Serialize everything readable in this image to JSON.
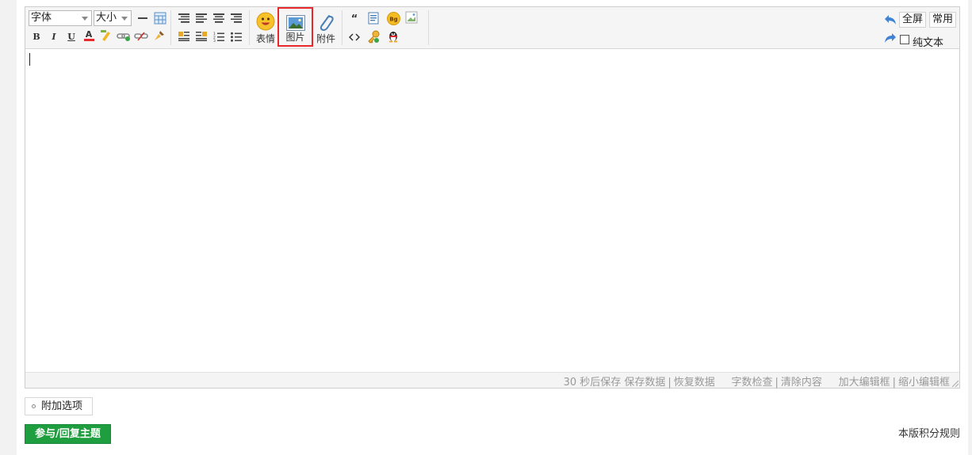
{
  "toolbar": {
    "font_select": "字体",
    "size_select": "大小",
    "emoticon_label": "表情",
    "image_label": "图片",
    "attachment_label": "附件",
    "bold_glyph": "B",
    "italic_glyph": "I",
    "underline_glyph": "U",
    "color_glyph": "A",
    "quote_glyph": "“",
    "bg_glyph": "Bg",
    "fullscreen_label": "全屏",
    "common_label": "常用",
    "plaintext_label": "纯文本"
  },
  "status": {
    "autosave": "30 秒后保存",
    "save_data": "保存数据",
    "restore_data": "恢复数据",
    "word_check": "字数检查",
    "clear_content": "清除内容",
    "enlarge": "加大编辑框",
    "shrink": "缩小编辑框",
    "pipe": "|"
  },
  "footer": {
    "options_label": "附加选项",
    "submit_label": "参与/回复主题",
    "rules_link": "本版积分规则"
  },
  "colors": {
    "accent_green": "#1e9e3e",
    "highlight_red": "#e8292c"
  }
}
